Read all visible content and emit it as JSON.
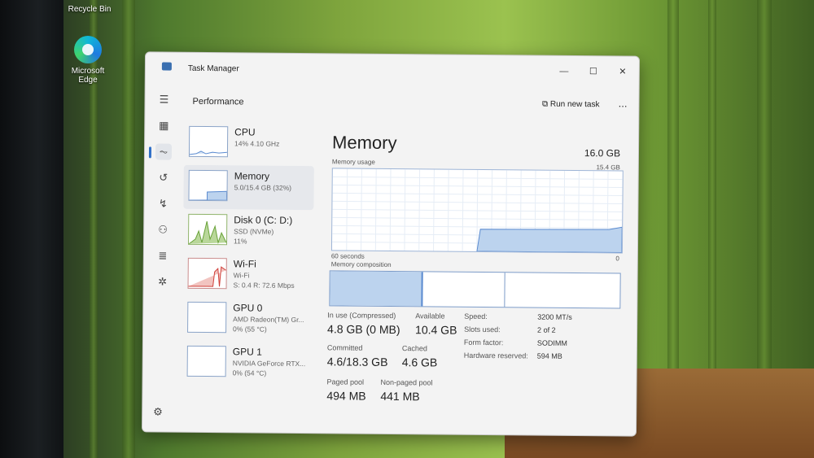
{
  "desktop": {
    "recycle_bin_label": "Recycle Bin",
    "edge_label_line1": "Microsoft",
    "edge_label_line2": "Edge"
  },
  "window": {
    "title": "Task Manager",
    "minimize_icon": "minimize-icon",
    "maximize_icon": "maximize-icon",
    "close_icon": "close-icon"
  },
  "header": {
    "title": "Performance",
    "run_new_task": "Run new task",
    "more": "..."
  },
  "sidebar_list": [
    {
      "name": "CPU",
      "sub1": "14%  4.10 GHz",
      "sub2": ""
    },
    {
      "name": "Memory",
      "sub1": "5.0/15.4 GB (32%)",
      "sub2": ""
    },
    {
      "name": "Disk 0 (C: D:)",
      "sub1": "SSD (NVMe)",
      "sub2": "11%"
    },
    {
      "name": "Wi-Fi",
      "sub1": "Wi-Fi",
      "sub2": "S: 0.4  R: 72.6 Mbps"
    },
    {
      "name": "GPU 0",
      "sub1": "AMD Radeon(TM) Gr...",
      "sub2": "0%  (55 °C)"
    },
    {
      "name": "GPU 1",
      "sub1": "NVIDIA GeForce RTX...",
      "sub2": "0%  (54 °C)"
    }
  ],
  "memory": {
    "title": "Memory",
    "total": "16.0 GB",
    "usage_label": "Memory usage",
    "usage_max": "15.4 GB",
    "time_span": "60 seconds",
    "zero": "0",
    "composition_label": "Memory composition",
    "usage_fraction": 0.32,
    "stats": {
      "in_use_label": "In use (Compressed)",
      "in_use_value": "4.8 GB (0 MB)",
      "available_label": "Available",
      "available_value": "10.4 GB",
      "committed_label": "Committed",
      "committed_value": "4.6/18.3 GB",
      "cached_label": "Cached",
      "cached_value": "4.6 GB",
      "paged_label": "Paged pool",
      "paged_value": "494 MB",
      "nonpaged_label": "Non-paged pool",
      "nonpaged_value": "441 MB"
    },
    "specs": {
      "speed_label": "Speed:",
      "speed_value": "3200 MT/s",
      "slots_label": "Slots used:",
      "slots_value": "2 of 2",
      "form_label": "Form factor:",
      "form_value": "SODIMM",
      "reserved_label": "Hardware reserved:",
      "reserved_value": "594 MB"
    }
  },
  "colors": {
    "accent": "#2f6fc8",
    "graph_fill": "#bcd3ee",
    "graph_line": "#5b8bd0",
    "disk_green": "#6aa33a",
    "wifi_red": "#d0403a"
  }
}
